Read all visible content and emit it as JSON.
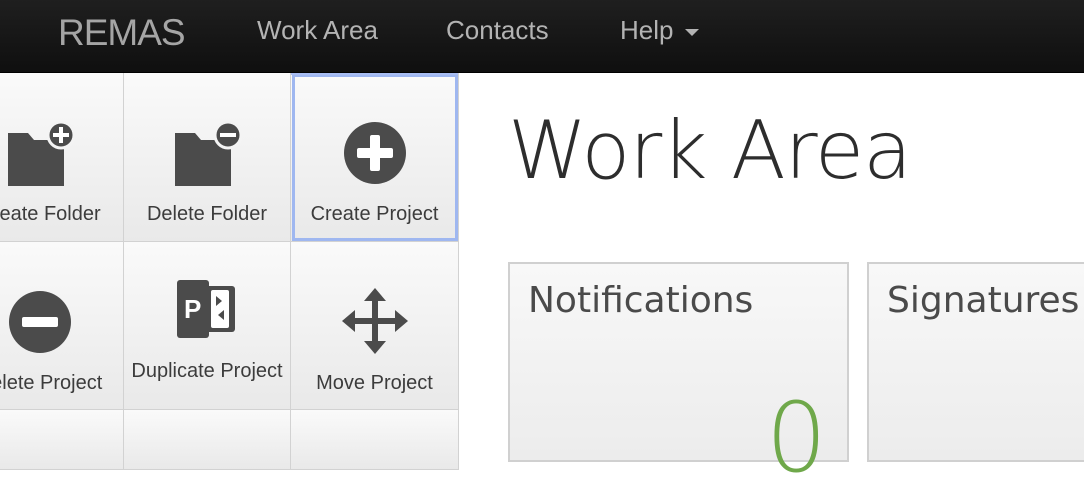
{
  "navbar": {
    "brand": "REMAS",
    "links": [
      {
        "label": "Work Area"
      },
      {
        "label": "Contacts"
      },
      {
        "label": "Help"
      }
    ]
  },
  "tiles": [
    {
      "label": "Create Folder",
      "icon": "folder-add-icon"
    },
    {
      "label": "Delete Folder",
      "icon": "folder-remove-icon"
    },
    {
      "label": "Create Project",
      "icon": "plus-circle-icon",
      "selected": true
    },
    {
      "label": "Delete Project",
      "icon": "minus-circle-icon"
    },
    {
      "label": "Duplicate Project",
      "icon": "duplicate-project-icon"
    },
    {
      "label": "Move Project",
      "icon": "move-arrows-icon"
    }
  ],
  "main": {
    "title": "Work Area",
    "panels": [
      {
        "title": "Notifications",
        "count": "0"
      },
      {
        "title": "Signatures"
      }
    ]
  },
  "colors": {
    "navbar_bg": "#161616",
    "accent_green": "#6fa84a",
    "selection_blue": "#a8bdf2",
    "icon_gray": "#4b4b4b"
  }
}
